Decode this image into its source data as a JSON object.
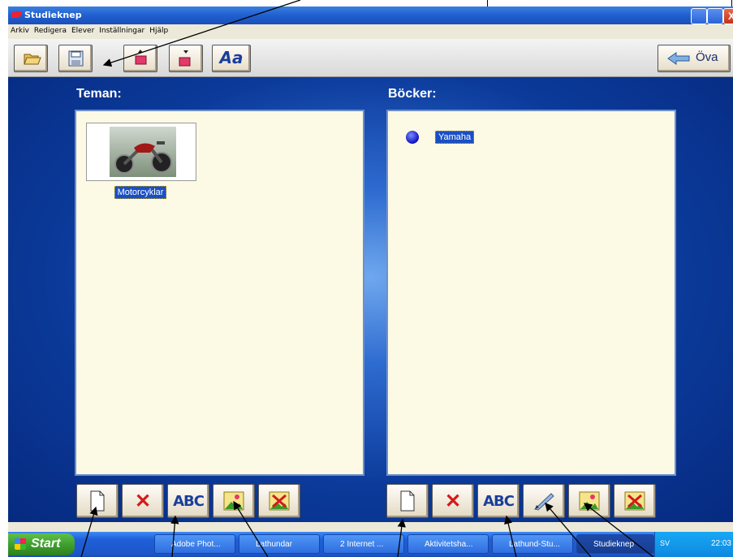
{
  "window": {
    "title": "Studieknep",
    "close_label": "X"
  },
  "menu": [
    "Arkiv",
    "Redigera",
    "Elever",
    "Inställningar",
    "Hjälp"
  ],
  "toolbar": {
    "text_size_label": "Aa",
    "practice_label": "Öva"
  },
  "left_panel": {
    "heading": "Teman:",
    "items": [
      {
        "label": "Motorcyklar"
      }
    ]
  },
  "right_panel": {
    "heading": "Böcker:",
    "items": [
      {
        "label": "Yamaha"
      }
    ]
  },
  "buttons": {
    "spell_label": "ABC"
  },
  "taskbar": {
    "start_label": "Start",
    "tasks": [
      "Adobe Phot...",
      "Lathundar",
      "2 Internet ...",
      "Aktivitetsha...",
      "Lathund-Stu...",
      "Studieknep"
    ],
    "lang": "SV",
    "clock": "22:03"
  },
  "icons": [
    "folder-open-icon",
    "save-icon",
    "move-up-icon",
    "move-down-icon",
    "new-page-icon",
    "delete-icon",
    "picture-icon",
    "remove-picture-icon",
    "pen-icon",
    "arrow-left-icon"
  ]
}
